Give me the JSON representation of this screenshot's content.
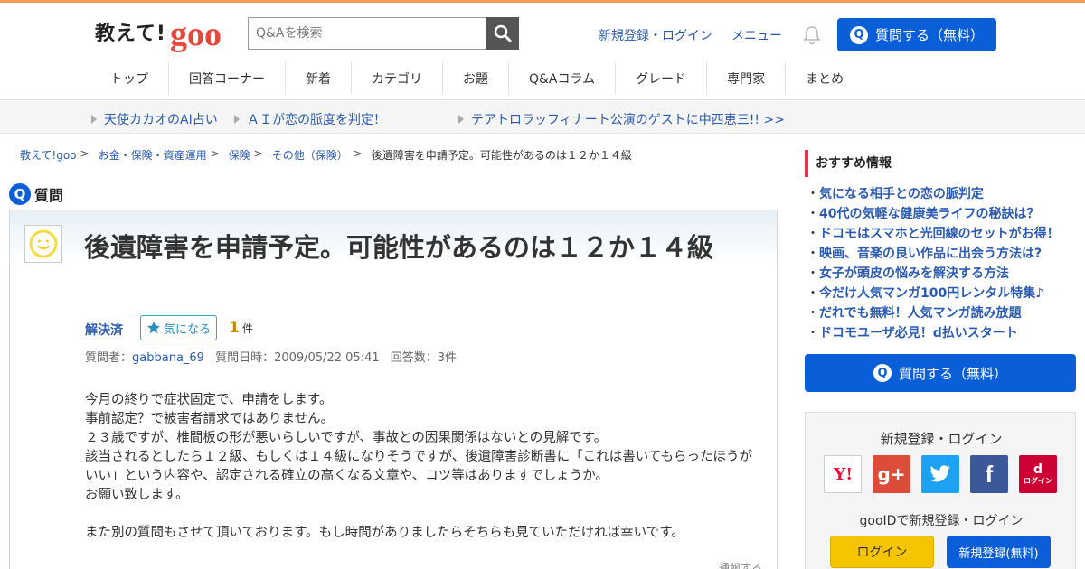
{
  "header": {
    "logo_text": "教えて!",
    "logo_brand": "goo",
    "search_placeholder": "Q&Aを検索",
    "register_login": "新規登録・ログイン",
    "menu": "メニュー",
    "ask_button": "質問する（無料）"
  },
  "nav": [
    {
      "label": "トップ"
    },
    {
      "label": "回答コーナー"
    },
    {
      "label": "新着"
    },
    {
      "label": "カテゴリ"
    },
    {
      "label": "お題"
    },
    {
      "label": "Q&Aコラム"
    },
    {
      "label": "グレード"
    },
    {
      "label": "専門家"
    },
    {
      "label": "まとめ"
    }
  ],
  "subbar": [
    {
      "label": "天使カカオのAI占い"
    },
    {
      "label": "ＡＩが恋の脈度を判定！"
    },
    {
      "label": "テアトロラッフィナート公演のゲストに中西恵三!! >>"
    }
  ],
  "breadcrumb": [
    {
      "label": "教えて!goo"
    },
    {
      "label": "お金・保険・資産運用"
    },
    {
      "label": "保険"
    },
    {
      "label": "その他（保険）"
    }
  ],
  "breadcrumb_current": "後遺障害を申請予定。可能性があるのは１２か１４級",
  "question": {
    "section_label": "質問",
    "q_mark": "Q",
    "title": "後遺障害を申請予定。可能性があるのは１２か１４級",
    "solved_label": "解決済",
    "kininaru_label": "気になる",
    "kininaru_count": "1",
    "count_unit": "件",
    "meta_asker_label": "質問者：",
    "meta_asker": "gabbana_69",
    "meta_date": "質問日時：2009/05/22 05:41",
    "meta_answers": "回答数：3件",
    "body": [
      "今月の終りで症状固定で、申請をします。",
      "事前認定？で被害者請求ではありません。",
      "２３歳ですが、椎間板の形が悪いらしいですが、事故との因果関係はないとの見解です。",
      "該当されるとしたら１２級、もしくは１４級になりそうですが、後遺障害診断書に「これは書いてもらったほうがいい」という内容や、認定される確立の高くなる文章や、コツ等はありますでしょうか。",
      "お願い致します。",
      "",
      "また別の質問もさせて頂いております。もし時間がありましたらそちらも見ていただければ幸いです。"
    ],
    "report": "通報する"
  },
  "sidebar": {
    "title": "おすすめ情報",
    "items": [
      "気になる相手との恋の脈判定",
      "40代の気軽な健康美ライフの秘訣は？",
      "ドコモはスマホと光回線のセットがお得！",
      "映画、音楽の良い作品に出会う方法は?",
      "女子が頭皮の悩みを解決する方法",
      "今だけ人気マンガ100円レンタル特集♪",
      "だれでも無料！人気マンガ読み放題",
      "ドコモユーザ必見！d払いスタート"
    ],
    "ask_button": "質問する（無料）",
    "login_title": "新規登録・ログイン",
    "sns_yahoo": "Y!",
    "sns_google": "g+",
    "sns_facebook": "f",
    "sns_d": "d",
    "sns_d_label": "ログイン",
    "gooid_text": "gooIDで新規登録・ログイン",
    "login_button": "ログイン",
    "register_button": "新規登録(無料)"
  },
  "colors": {
    "accent_blue": "#0a5ed8",
    "link_blue": "#2a5bb0",
    "logo_red": "#e8473b",
    "top_line": "#f39c5a"
  }
}
